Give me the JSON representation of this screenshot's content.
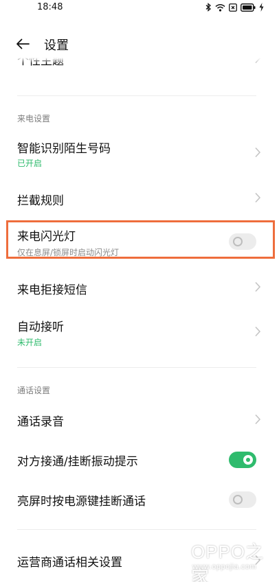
{
  "status_bar": {
    "time": "18:48",
    "icons": [
      "bluetooth-icon",
      "wifi-icon",
      "sim-icon",
      "battery-icon",
      "charging-icon"
    ]
  },
  "header": {
    "back_icon": "back-arrow-icon",
    "title": "设置"
  },
  "list": {
    "partial_item": {
      "label": "个性主题"
    },
    "section_incoming": {
      "label": "来电设置",
      "items": [
        {
          "title": "智能识别陌生号码",
          "subtitle": "已开启",
          "control": "chevron"
        },
        {
          "title": "拦截规则",
          "control": "chevron"
        },
        {
          "title": "来电闪光灯",
          "subtitle": "仅在息屏/锁屏时启动闪光灯",
          "control": "toggle",
          "toggle_on": false
        },
        {
          "title": "来电拒接短信",
          "control": "chevron"
        },
        {
          "title": "自动接听",
          "subtitle": "未开启",
          "control": "chevron"
        }
      ]
    },
    "section_call": {
      "label": "通话设置",
      "items": [
        {
          "title": "通话录音",
          "control": "chevron"
        },
        {
          "title": "对方接通/挂断振动提示",
          "control": "toggle",
          "toggle_on": true
        },
        {
          "title": "亮屏时按电源键挂断通话",
          "control": "toggle",
          "toggle_on": false
        }
      ]
    },
    "bottom_item": {
      "title": "运营商通话相关设置",
      "control": "chevron"
    }
  },
  "watermark": {
    "brand": "OPPO之家",
    "url": "www.oppojia.com"
  },
  "colors": {
    "accent_green": "#2fbb6d",
    "highlight_orange": "#ee6d3c"
  }
}
